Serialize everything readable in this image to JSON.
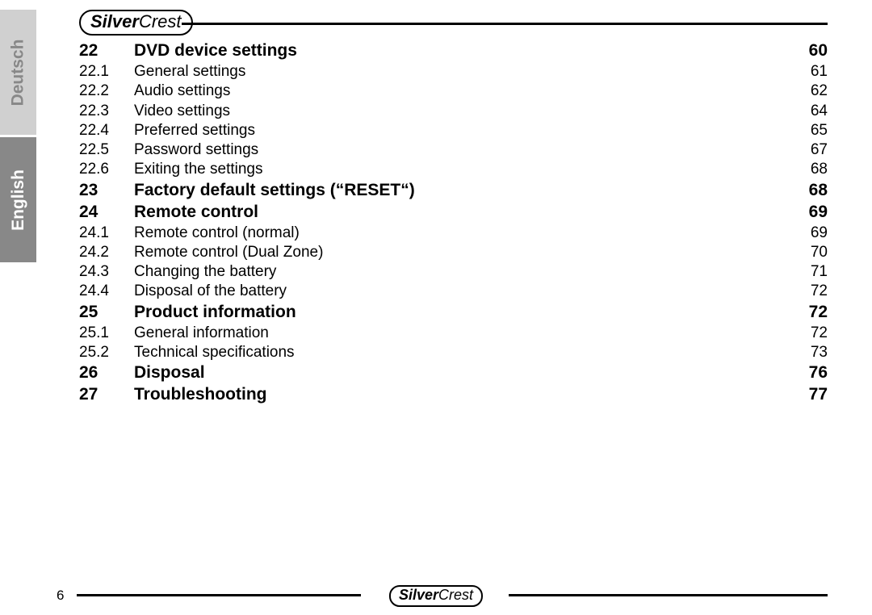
{
  "brand": "SilverCrest",
  "page_number": "6",
  "languages": {
    "inactive": "Deutsch",
    "active": "English"
  },
  "toc": [
    {
      "type": "main",
      "num": "22",
      "title": "DVD device settings",
      "page": "60"
    },
    {
      "type": "sub",
      "num": "22.1",
      "title": "General settings",
      "page": "61"
    },
    {
      "type": "sub",
      "num": "22.2",
      "title": "Audio settings",
      "page": "62"
    },
    {
      "type": "sub",
      "num": "22.3",
      "title": "Video settings",
      "page": "64"
    },
    {
      "type": "sub",
      "num": "22.4",
      "title": "Preferred settings",
      "page": "65"
    },
    {
      "type": "sub",
      "num": "22.5",
      "title": "Password settings",
      "page": "67"
    },
    {
      "type": "sub",
      "num": "22.6",
      "title": "Exiting the settings",
      "page": "68"
    },
    {
      "type": "main",
      "num": "23",
      "title": "Factory default settings (“RESET“)",
      "page": "68"
    },
    {
      "type": "main",
      "num": "24",
      "title": "Remote control",
      "page": "69"
    },
    {
      "type": "sub",
      "num": "24.1",
      "title": "Remote control (normal)",
      "page": "69"
    },
    {
      "type": "sub",
      "num": "24.2",
      "title": "Remote control (Dual Zone)",
      "page": "70"
    },
    {
      "type": "sub",
      "num": "24.3",
      "title": "Changing the battery",
      "page": "71"
    },
    {
      "type": "sub",
      "num": "24.4",
      "title": "Disposal of the battery",
      "page": "72"
    },
    {
      "type": "main",
      "num": "25",
      "title": "Product information",
      "page": "72"
    },
    {
      "type": "sub",
      "num": "25.1",
      "title": "General information",
      "page": "72"
    },
    {
      "type": "sub",
      "num": "25.2",
      "title": "Technical specifications",
      "page": "73"
    },
    {
      "type": "main",
      "num": "26",
      "title": "Disposal",
      "page": "76"
    },
    {
      "type": "main",
      "num": "27",
      "title": "Troubleshooting",
      "page": "77"
    }
  ]
}
